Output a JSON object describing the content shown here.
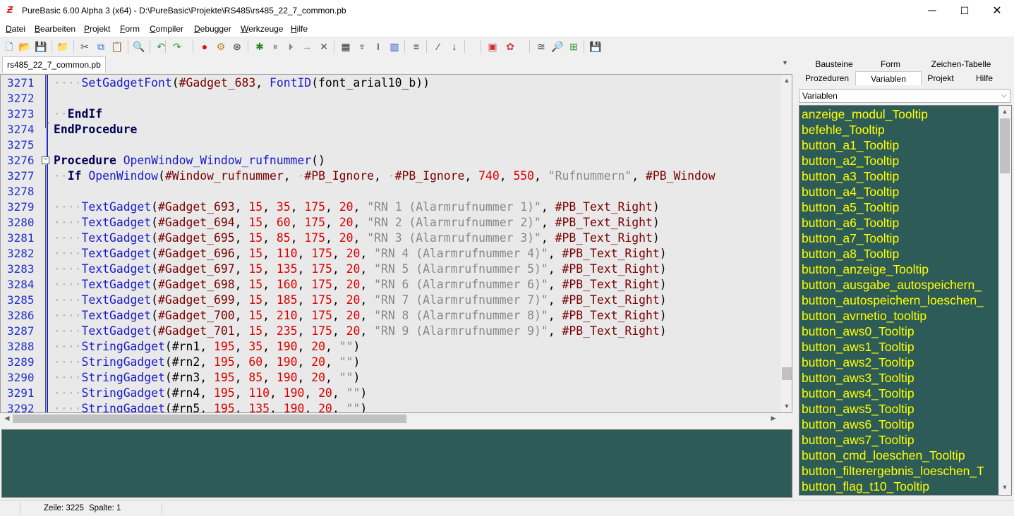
{
  "window": {
    "title": "PureBasic 6.00 Alpha 3 (x64) - D:\\PureBasic\\Projekte\\RS485\\rs485_22_7_common.pb",
    "minimize": "─",
    "maximize": "☐",
    "close": "✕"
  },
  "menu": [
    {
      "label": "Datei",
      "accel": "D"
    },
    {
      "label": "Bearbeiten",
      "accel": "B"
    },
    {
      "label": "Projekt",
      "accel": "P"
    },
    {
      "label": "Form",
      "accel": "F"
    },
    {
      "label": "Compiler",
      "accel": "C"
    },
    {
      "label": "Debugger",
      "accel": "D"
    },
    {
      "label": "Werkzeuge",
      "accel": "W"
    },
    {
      "label": "Hilfe",
      "accel": "H"
    }
  ],
  "toolbar_icons": [
    "new-file-icon",
    "open-file-icon",
    "save-icon",
    "open-folder-icon",
    "cut-icon",
    "copy-icon",
    "paste-icon",
    "find-icon",
    "undo-icon",
    "redo-icon",
    "compile-run-icon",
    "build-icon",
    "debug-icon",
    "debugger-icon",
    "pause-icon",
    "step-icon",
    "step-over-icon",
    "stop-icon",
    "form-icon",
    "tool-icon",
    "tool2-icon",
    "structure-viewer-icon",
    "format-icon",
    "toggle-comment-icon",
    "jump-icon",
    "color-picker-icon",
    "palette-icon",
    "tool3-icon",
    "search-icon",
    "tool4-icon",
    "save-all-icon"
  ],
  "file_tab": "rs485_22_7_common.pb",
  "editor": {
    "lines": [
      {
        "n": "3271",
        "parts": [
          [
            "dot",
            "····"
          ],
          [
            "fn",
            "SetGadgetFont"
          ],
          [
            "",
            "("
          ],
          [
            "cn",
            "#Gadget_683"
          ],
          [
            "",
            ", "
          ],
          [
            "fn",
            "FontID"
          ],
          [
            "",
            "(font_arial10_b))"
          ]
        ]
      },
      {
        "n": "3272",
        "parts": []
      },
      {
        "n": "3273",
        "parts": [
          [
            "dot",
            "··"
          ],
          [
            "kw",
            "EndIf"
          ]
        ]
      },
      {
        "n": "3274",
        "parts": [
          [
            "kw",
            "EndProcedure"
          ]
        ]
      },
      {
        "n": "3275",
        "parts": []
      },
      {
        "n": "3276",
        "parts": [
          [
            "kw",
            "Procedure"
          ],
          [
            "",
            " "
          ],
          [
            "fn",
            "OpenWindow_Window_rufnummer"
          ],
          [
            "",
            "()"
          ]
        ]
      },
      {
        "n": "3277",
        "parts": [
          [
            "dot",
            "··"
          ],
          [
            "kw",
            "If"
          ],
          [
            "",
            " "
          ],
          [
            "fn",
            "OpenWindow"
          ],
          [
            "",
            "("
          ],
          [
            "cn",
            "#Window_rufnummer"
          ],
          [
            "",
            ", "
          ],
          [
            "dot",
            "·"
          ],
          [
            "cn",
            "#PB_Ignore"
          ],
          [
            "",
            ", "
          ],
          [
            "dot",
            "·"
          ],
          [
            "cn",
            "#PB_Ignore"
          ],
          [
            "",
            ", "
          ],
          [
            "nu",
            "740"
          ],
          [
            "",
            ", "
          ],
          [
            "nu",
            "550"
          ],
          [
            "",
            ", "
          ],
          [
            "st",
            "\"Rufnummern\""
          ],
          [
            "",
            ", "
          ],
          [
            "cn",
            "#PB_Window"
          ]
        ]
      },
      {
        "n": "3278",
        "parts": []
      },
      {
        "n": "3279",
        "parts": [
          [
            "dot",
            "····"
          ],
          [
            "fn",
            "TextGadget"
          ],
          [
            "",
            "("
          ],
          [
            "cn",
            "#Gadget_693"
          ],
          [
            "",
            ", "
          ],
          [
            "nu",
            "15"
          ],
          [
            "",
            ", "
          ],
          [
            "nu",
            "35"
          ],
          [
            "",
            ", "
          ],
          [
            "nu",
            "175"
          ],
          [
            "",
            ", "
          ],
          [
            "nu",
            "20"
          ],
          [
            "",
            ", "
          ],
          [
            "st",
            "\"RN 1 (Alarmrufnummer 1)\""
          ],
          [
            "",
            ", "
          ],
          [
            "cn",
            "#PB_Text_Right"
          ],
          [
            "",
            ")"
          ]
        ]
      },
      {
        "n": "3280",
        "parts": [
          [
            "dot",
            "····"
          ],
          [
            "fn",
            "TextGadget"
          ],
          [
            "",
            "("
          ],
          [
            "cn",
            "#Gadget_694"
          ],
          [
            "",
            ", "
          ],
          [
            "nu",
            "15"
          ],
          [
            "",
            ", "
          ],
          [
            "nu",
            "60"
          ],
          [
            "",
            ", "
          ],
          [
            "nu",
            "175"
          ],
          [
            "",
            ", "
          ],
          [
            "nu",
            "20"
          ],
          [
            "",
            ", "
          ],
          [
            "st",
            "\"RN 2 (Alarmrufnummer 2)\""
          ],
          [
            "",
            ", "
          ],
          [
            "cn",
            "#PB_Text_Right"
          ],
          [
            "",
            ")"
          ]
        ]
      },
      {
        "n": "3281",
        "parts": [
          [
            "dot",
            "····"
          ],
          [
            "fn",
            "TextGadget"
          ],
          [
            "",
            "("
          ],
          [
            "cn",
            "#Gadget_695"
          ],
          [
            "",
            ", "
          ],
          [
            "nu",
            "15"
          ],
          [
            "",
            ", "
          ],
          [
            "nu",
            "85"
          ],
          [
            "",
            ", "
          ],
          [
            "nu",
            "175"
          ],
          [
            "",
            ", "
          ],
          [
            "nu",
            "20"
          ],
          [
            "",
            ", "
          ],
          [
            "st",
            "\"RN 3 (Alarmrufnummer 3)\""
          ],
          [
            "",
            ", "
          ],
          [
            "cn",
            "#PB_Text_Right"
          ],
          [
            "",
            ")"
          ]
        ]
      },
      {
        "n": "3282",
        "parts": [
          [
            "dot",
            "····"
          ],
          [
            "fn",
            "TextGadget"
          ],
          [
            "",
            "("
          ],
          [
            "cn",
            "#Gadget_696"
          ],
          [
            "",
            ", "
          ],
          [
            "nu",
            "15"
          ],
          [
            "",
            ", "
          ],
          [
            "nu",
            "110"
          ],
          [
            "",
            ", "
          ],
          [
            "nu",
            "175"
          ],
          [
            "",
            ", "
          ],
          [
            "nu",
            "20"
          ],
          [
            "",
            ", "
          ],
          [
            "st",
            "\"RN 4 (Alarmrufnummer 4)\""
          ],
          [
            "",
            ", "
          ],
          [
            "cn",
            "#PB_Text_Right"
          ],
          [
            "",
            ")"
          ]
        ]
      },
      {
        "n": "3283",
        "parts": [
          [
            "dot",
            "····"
          ],
          [
            "fn",
            "TextGadget"
          ],
          [
            "",
            "("
          ],
          [
            "cn",
            "#Gadget_697"
          ],
          [
            "",
            ", "
          ],
          [
            "nu",
            "15"
          ],
          [
            "",
            ", "
          ],
          [
            "nu",
            "135"
          ],
          [
            "",
            ", "
          ],
          [
            "nu",
            "175"
          ],
          [
            "",
            ", "
          ],
          [
            "nu",
            "20"
          ],
          [
            "",
            ", "
          ],
          [
            "st",
            "\"RN 5 (Alarmrufnummer 5)\""
          ],
          [
            "",
            ", "
          ],
          [
            "cn",
            "#PB_Text_Right"
          ],
          [
            "",
            ")"
          ]
        ]
      },
      {
        "n": "3284",
        "parts": [
          [
            "dot",
            "····"
          ],
          [
            "fn",
            "TextGadget"
          ],
          [
            "",
            "("
          ],
          [
            "cn",
            "#Gadget_698"
          ],
          [
            "",
            ", "
          ],
          [
            "nu",
            "15"
          ],
          [
            "",
            ", "
          ],
          [
            "nu",
            "160"
          ],
          [
            "",
            ", "
          ],
          [
            "nu",
            "175"
          ],
          [
            "",
            ", "
          ],
          [
            "nu",
            "20"
          ],
          [
            "",
            ", "
          ],
          [
            "st",
            "\"RN 6 (Alarmrufnummer 6)\""
          ],
          [
            "",
            ", "
          ],
          [
            "cn",
            "#PB_Text_Right"
          ],
          [
            "",
            ")"
          ]
        ]
      },
      {
        "n": "3285",
        "parts": [
          [
            "dot",
            "····"
          ],
          [
            "fn",
            "TextGadget"
          ],
          [
            "",
            "("
          ],
          [
            "cn",
            "#Gadget_699"
          ],
          [
            "",
            ", "
          ],
          [
            "nu",
            "15"
          ],
          [
            "",
            ", "
          ],
          [
            "nu",
            "185"
          ],
          [
            "",
            ", "
          ],
          [
            "nu",
            "175"
          ],
          [
            "",
            ", "
          ],
          [
            "nu",
            "20"
          ],
          [
            "",
            ", "
          ],
          [
            "st",
            "\"RN 7 (Alarmrufnummer 7)\""
          ],
          [
            "",
            ", "
          ],
          [
            "cn",
            "#PB_Text_Right"
          ],
          [
            "",
            ")"
          ]
        ]
      },
      {
        "n": "3286",
        "parts": [
          [
            "dot",
            "····"
          ],
          [
            "fn",
            "TextGadget"
          ],
          [
            "",
            "("
          ],
          [
            "cn",
            "#Gadget_700"
          ],
          [
            "",
            ", "
          ],
          [
            "nu",
            "15"
          ],
          [
            "",
            ", "
          ],
          [
            "nu",
            "210"
          ],
          [
            "",
            ", "
          ],
          [
            "nu",
            "175"
          ],
          [
            "",
            ", "
          ],
          [
            "nu",
            "20"
          ],
          [
            "",
            ", "
          ],
          [
            "st",
            "\"RN 8 (Alarmrufnummer 8)\""
          ],
          [
            "",
            ", "
          ],
          [
            "cn",
            "#PB_Text_Right"
          ],
          [
            "",
            ")"
          ]
        ]
      },
      {
        "n": "3287",
        "parts": [
          [
            "dot",
            "····"
          ],
          [
            "fn",
            "TextGadget"
          ],
          [
            "",
            "("
          ],
          [
            "cn",
            "#Gadget_701"
          ],
          [
            "",
            ", "
          ],
          [
            "nu",
            "15"
          ],
          [
            "",
            ", "
          ],
          [
            "nu",
            "235"
          ],
          [
            "",
            ", "
          ],
          [
            "nu",
            "175"
          ],
          [
            "",
            ", "
          ],
          [
            "nu",
            "20"
          ],
          [
            "",
            ", "
          ],
          [
            "st",
            "\"RN 9 (Alarmrufnummer 9)\""
          ],
          [
            "",
            ", "
          ],
          [
            "cn",
            "#PB_Text_Right"
          ],
          [
            "",
            ")"
          ]
        ]
      },
      {
        "n": "3288",
        "parts": [
          [
            "dot",
            "····"
          ],
          [
            "fn",
            "StringGadget"
          ],
          [
            "",
            "(#rn1, "
          ],
          [
            "nu",
            "195"
          ],
          [
            "",
            ", "
          ],
          [
            "nu",
            "35"
          ],
          [
            "",
            ", "
          ],
          [
            "nu",
            "190"
          ],
          [
            "",
            ", "
          ],
          [
            "nu",
            "20"
          ],
          [
            "",
            ", "
          ],
          [
            "st",
            "\"\""
          ],
          [
            "",
            ")"
          ]
        ]
      },
      {
        "n": "3289",
        "parts": [
          [
            "dot",
            "····"
          ],
          [
            "fn",
            "StringGadget"
          ],
          [
            "",
            "(#rn2, "
          ],
          [
            "nu",
            "195"
          ],
          [
            "",
            ", "
          ],
          [
            "nu",
            "60"
          ],
          [
            "",
            ", "
          ],
          [
            "nu",
            "190"
          ],
          [
            "",
            ", "
          ],
          [
            "nu",
            "20"
          ],
          [
            "",
            ", "
          ],
          [
            "st",
            "\"\""
          ],
          [
            "",
            ")"
          ]
        ]
      },
      {
        "n": "3290",
        "parts": [
          [
            "dot",
            "····"
          ],
          [
            "fn",
            "StringGadget"
          ],
          [
            "",
            "(#rn3, "
          ],
          [
            "nu",
            "195"
          ],
          [
            "",
            ", "
          ],
          [
            "nu",
            "85"
          ],
          [
            "",
            ", "
          ],
          [
            "nu",
            "190"
          ],
          [
            "",
            ", "
          ],
          [
            "nu",
            "20"
          ],
          [
            "",
            ", "
          ],
          [
            "st",
            "\"\""
          ],
          [
            "",
            ")"
          ]
        ]
      },
      {
        "n": "3291",
        "parts": [
          [
            "dot",
            "····"
          ],
          [
            "fn",
            "StringGadget"
          ],
          [
            "",
            "(#rn4, "
          ],
          [
            "nu",
            "195"
          ],
          [
            "",
            ", "
          ],
          [
            "nu",
            "110"
          ],
          [
            "",
            ", "
          ],
          [
            "nu",
            "190"
          ],
          [
            "",
            ", "
          ],
          [
            "nu",
            "20"
          ],
          [
            "",
            ", "
          ],
          [
            "st",
            "\"\""
          ],
          [
            "",
            ")"
          ]
        ]
      },
      {
        "n": "3292",
        "parts": [
          [
            "dot",
            "····"
          ],
          [
            "fn",
            "StringGadget"
          ],
          [
            "",
            "(#rn5, "
          ],
          [
            "nu",
            "195"
          ],
          [
            "",
            ", "
          ],
          [
            "nu",
            "135"
          ],
          [
            "",
            ", "
          ],
          [
            "nu",
            "190"
          ],
          [
            "",
            ", "
          ],
          [
            "nu",
            "20"
          ],
          [
            "",
            ", "
          ],
          [
            "st",
            "\"\""
          ],
          [
            "",
            ")"
          ]
        ]
      }
    ]
  },
  "panel": {
    "tabs_row1": [
      "Bausteine",
      "Form",
      "Zeichen-Tabelle"
    ],
    "tabs_row2": [
      "Prozeduren",
      "Variablen",
      "Projekt",
      "Hilfe"
    ],
    "active_tab": "Variablen",
    "select_value": "Variablen",
    "variables": [
      "anzeige_modul_Tooltip",
      "befehle_Tooltip",
      "button_a1_Tooltip",
      "button_a2_Tooltip",
      "button_a3_Tooltip",
      "button_a4_Tooltip",
      "button_a5_Tooltip",
      "button_a6_Tooltip",
      "button_a7_Tooltip",
      "button_a8_Tooltip",
      "button_anzeige_Tooltip",
      "button_ausgabe_autospeichern_",
      "button_autospeichern_loeschen_",
      "button_avrnetio_tooltip",
      "button_aws0_Tooltip",
      "button_aws1_Tooltip",
      "button_aws2_Tooltip",
      "button_aws3_Tooltip",
      "button_aws4_Tooltip",
      "button_aws5_Tooltip",
      "button_aws6_Tooltip",
      "button_aws7_Tooltip",
      "button_cmd_loeschen_Tooltip",
      "button_filterergebnis_loeschen_T",
      "button_flag_t10_Tooltip"
    ]
  },
  "status": {
    "line": "Zeile: 3225",
    "column": "Spalte: 1"
  },
  "colors": {
    "output_bg": "#2d5c58",
    "variable_text": "#ffff00",
    "line_number": "#2233cc"
  }
}
